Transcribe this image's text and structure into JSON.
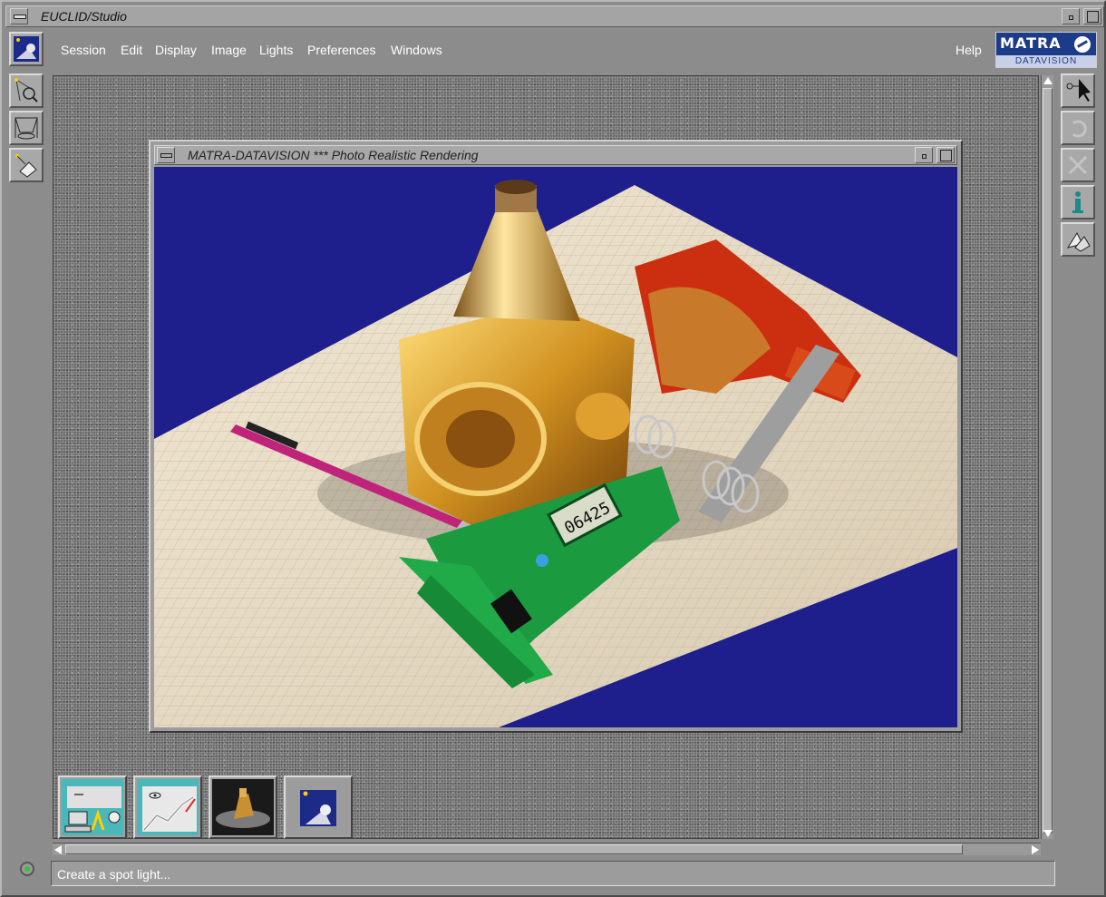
{
  "app": {
    "title": "EUCLID/Studio"
  },
  "menubar": {
    "items": [
      "Session",
      "Edit",
      "Display",
      "Image",
      "Lights",
      "Preferences",
      "Windows"
    ],
    "help": "Help"
  },
  "logo": {
    "top": "MATRA",
    "bottom": "DATAVISION"
  },
  "left_tools": [
    {
      "icon": "app-scene-icon"
    },
    {
      "icon": "spot-light-magnifier-icon"
    },
    {
      "icon": "plane-projection-icon"
    },
    {
      "icon": "light-shape-icon"
    }
  ],
  "right_tools": [
    {
      "icon": "pointer-select-icon"
    },
    {
      "icon": "undo-icon"
    },
    {
      "icon": "close-x-icon"
    },
    {
      "icon": "info-icon"
    },
    {
      "icon": "shapes-icon"
    }
  ],
  "subwindow": {
    "title": "MATRA-DATAVISION *** Photo Realistic Rendering",
    "caliper_reading": "06425"
  },
  "thumbnails": [
    {
      "icon": "session-computer-icon"
    },
    {
      "icon": "display-graph-icon"
    },
    {
      "icon": "rendered-image-icon"
    },
    {
      "icon": "scene-lights-icon"
    }
  ],
  "status": {
    "text": "Create a spot light..."
  },
  "colors": {
    "background": "#8c8c8c",
    "render_background": "#1e1e8c",
    "logo_blue": "#1c3b88",
    "status_led": "#3ac03a"
  }
}
